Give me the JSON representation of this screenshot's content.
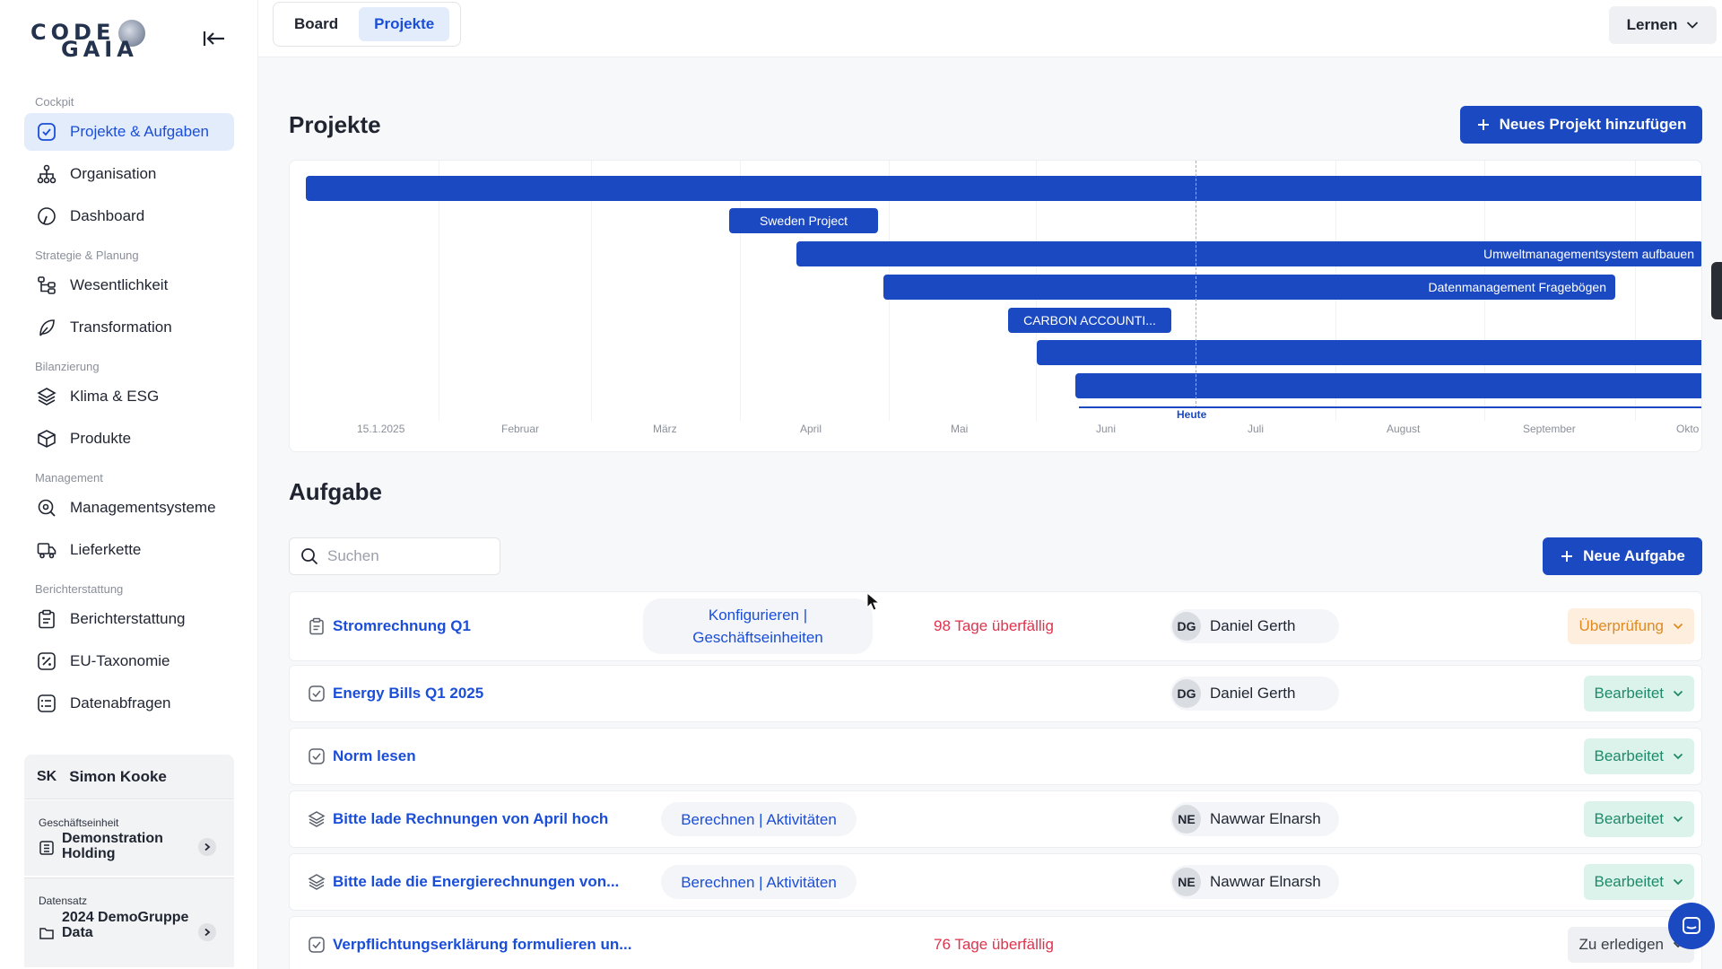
{
  "sidebar": {
    "logo": {
      "top": "CODE",
      "bottom": "GAIA"
    },
    "sections": [
      {
        "label": "Cockpit"
      },
      {
        "label": "Strategie & Planung"
      },
      {
        "label": "Bilanzierung"
      },
      {
        "label": "Management"
      },
      {
        "label": "Berichterstattung"
      }
    ],
    "items": [
      {
        "label": "Projekte & Aufgaben",
        "icon": "check-square-icon",
        "active": true
      },
      {
        "label": "Organisation",
        "icon": "org-chart-icon"
      },
      {
        "label": "Dashboard",
        "icon": "gauge-icon"
      },
      {
        "label": "Wesentlichkeit",
        "icon": "hierarchy-icon"
      },
      {
        "label": "Transformation",
        "icon": "leaf-icon"
      },
      {
        "label": "Klima & ESG",
        "icon": "layers-icon"
      },
      {
        "label": "Produkte",
        "icon": "package-icon"
      },
      {
        "label": "Managementsysteme",
        "icon": "search-settings-icon"
      },
      {
        "label": "Lieferkette",
        "icon": "truck-icon"
      },
      {
        "label": "Berichterstattung",
        "icon": "clipboard-icon"
      },
      {
        "label": "EU-Taxonomie",
        "icon": "percent-icon"
      },
      {
        "label": "Datenabfragen",
        "icon": "list-icon"
      }
    ],
    "user": {
      "initials": "SK",
      "name": "Simon Kooke"
    },
    "business_unit": {
      "label": "Geschäftseinheit",
      "value": "Demonstration Holding"
    },
    "dataset": {
      "label": "Datensatz",
      "value": "2024 DemoGruppe Data"
    }
  },
  "topbar": {
    "tabs": [
      {
        "label": "Board"
      },
      {
        "label": "Projekte",
        "active": true
      }
    ],
    "learn_label": "Lernen"
  },
  "projects": {
    "title": "Projekte",
    "add_button": "Neues Projekt hinzufügen",
    "bars": [
      {
        "label": ""
      },
      {
        "label": "Sweden Project"
      },
      {
        "label": "Umweltmanagementsystem aufbauen"
      },
      {
        "label": "Datenmanagement Fragebögen"
      },
      {
        "label": "CARBON ACCOUNTI..."
      },
      {
        "label": ""
      },
      {
        "label": ""
      }
    ],
    "today_label": "Heute",
    "months": [
      "15.1.2025",
      "Februar",
      "März",
      "April",
      "Mai",
      "Juni",
      "Juli",
      "August",
      "September",
      "Okto"
    ]
  },
  "tasks": {
    "title": "Aufgabe",
    "search_placeholder": "Suchen",
    "new_button": "Neue Aufgabe",
    "rows": [
      {
        "title": "Stromrechnung Q1",
        "icon": "clipboard-icon",
        "tag": "Konfigurieren | Geschäftseinheiten",
        "overdue": "98 Tage überfällig",
        "assignee_initials": "DG",
        "assignee": "Daniel Gerth",
        "status": "Überprüfung",
        "status_kind": "review"
      },
      {
        "title": "Energy Bills Q1 2025",
        "icon": "check-square-icon",
        "tag": "",
        "overdue": "",
        "assignee_initials": "DG",
        "assignee": "Daniel Gerth",
        "status": "Bearbeitet",
        "status_kind": "progress"
      },
      {
        "title": "Norm lesen",
        "icon": "check-square-icon",
        "tag": "",
        "overdue": "",
        "assignee_initials": "",
        "assignee": "",
        "status": "Bearbeitet",
        "status_kind": "progress"
      },
      {
        "title": "Bitte lade Rechnungen von April hoch",
        "icon": "layers-icon",
        "tag": "Berechnen | Aktivitäten",
        "overdue": "",
        "assignee_initials": "NE",
        "assignee": "Nawwar Elnarsh",
        "status": "Bearbeitet",
        "status_kind": "progress"
      },
      {
        "title": "Bitte lade die Energierechnungen von...",
        "icon": "layers-icon",
        "tag": "Berechnen | Aktivitäten",
        "overdue": "",
        "assignee_initials": "NE",
        "assignee": "Nawwar Elnarsh",
        "status": "Bearbeitet",
        "status_kind": "progress"
      },
      {
        "title": "Verpflichtungserklärung formulieren un...",
        "icon": "check-square-icon",
        "tag": "",
        "overdue": "76 Tage überfällig",
        "assignee_initials": "",
        "assignee": "",
        "status": "Zu erledigen",
        "status_kind": "todo"
      }
    ]
  },
  "colors": {
    "primary": "#1b49c1",
    "active_bg": "#e3ecfb",
    "overdue": "#e0334d",
    "review": "#e08a23",
    "progress": "#1e8a68"
  }
}
